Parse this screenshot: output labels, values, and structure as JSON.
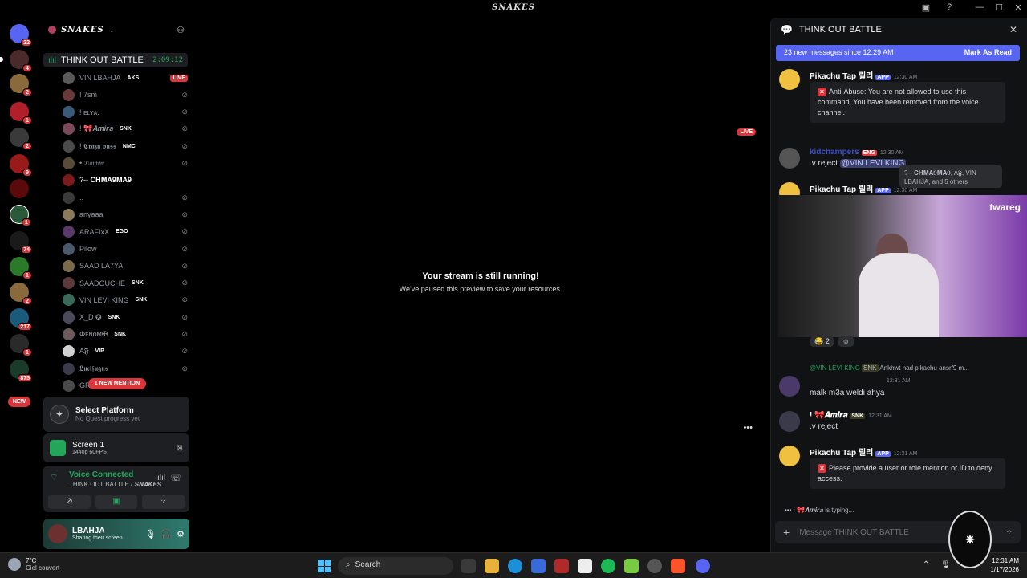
{
  "window": {
    "title": "𝑺𝑵𝑨𝑲𝑬𝑺",
    "minimize": "—",
    "maximize": "☐",
    "close": "✕"
  },
  "guilds": {
    "badges": [
      "22",
      "4",
      "2",
      "1",
      "2",
      "9",
      "1",
      "74",
      "1",
      "2",
      "217",
      "1",
      "875"
    ],
    "new_label": "NEW"
  },
  "server": {
    "name": "𝑺𝑵𝑨𝑲𝑬𝑺",
    "voice_channel": {
      "name": "THINK OUT BATTLE",
      "timer": "2:09:12"
    },
    "members": [
      {
        "name": "VIN LBAHJA",
        "tag": "AKS",
        "status": "LIVE"
      },
      {
        "name": "! 7sm",
        "tag": "",
        "status": ""
      },
      {
        "name": "! ᴇʟʏᴀ.",
        "tag": "",
        "status": ""
      },
      {
        "name": "! 🎀𝑨𝒎𝒊𝒓𝒂",
        "tag": "SNK",
        "status": ""
      },
      {
        "name": "! 𝕮𝖗𝖆𝖟𝖞 𝖕𝖚𝖘𝖘",
        "tag": "NMC",
        "status": ""
      },
      {
        "name": "• 𝔇𝔞𝔪𝔬𝔫",
        "tag": "",
        "status": ""
      },
      {
        "name": "?-- 𝐂𝐇𝐌𝐀𝟗𝐌𝐀𝟗",
        "tag": "",
        "status": ""
      },
      {
        "name": "..",
        "tag": "",
        "status": ""
      },
      {
        "name": "anyaaa",
        "tag": "",
        "status": ""
      },
      {
        "name": "ARAFIxX",
        "tag": "EGO",
        "status": ""
      },
      {
        "name": "Pilow",
        "tag": "",
        "status": ""
      },
      {
        "name": "SAAD LA7YA",
        "tag": "",
        "status": ""
      },
      {
        "name": "SAADOUCHE",
        "tag": "SNK",
        "status": ""
      },
      {
        "name": "VIN LEVI KING",
        "tag": "SNK",
        "status": ""
      },
      {
        "name": "X_D ✪",
        "tag": "SNK",
        "status": ""
      },
      {
        "name": "Φᴇɴᴏᴍ✠",
        "tag": "SNK",
        "status": ""
      },
      {
        "name": "A𝕱",
        "tag": "VIP",
        "status": ""
      },
      {
        "name": "𝕷𝖚𝖈𝖎𝖋𝖚𝖌𝖚𝖘",
        "tag": "",
        "status": ""
      },
      {
        "name": "GR",
        "tag": "",
        "status": ""
      }
    ],
    "mention_pill": "1 NEW MENTION"
  },
  "quest": {
    "title": "Select Platform",
    "subtitle": "No Quest progress yet"
  },
  "screen_share": {
    "title": "Screen 1",
    "quality": "1440p 60FPS"
  },
  "voice": {
    "status": "Voice Connected",
    "location": "THINK OUT BATTLE / 𝑺𝑵𝑨𝑲𝑬𝑺"
  },
  "user": {
    "name": "LBAHJA",
    "status": "Sharing their screen"
  },
  "stream": {
    "live": "LIVE",
    "heading": "Your stream is still running!",
    "subtext": "We've paused this preview to save your resources.",
    "more": "•••"
  },
  "chat": {
    "title": "THINK OUT BATTLE",
    "new_messages": "23 new messages since 12:29 AM",
    "mark_read": "Mark As Read",
    "msg1": {
      "author": "Pikachu Tap 릴리",
      "badge": "APP",
      "time": "12:30 AM",
      "embed": "Anti-Abuse: You are not allowed to use this command. You have been removed from the voice channel."
    },
    "tooltip": "?-- 𝐂𝐇𝐌𝐀𝟗𝐌𝐀𝟗, A𝕱, VIN LBAHJA, and 5 others",
    "msg2": {
      "author": "kidchampers",
      "tag": "ENG",
      "time": "12:30 AM",
      "body": ".v reject",
      "mention": "@VIN LEVI KING"
    },
    "msg3": {
      "author": "Pikachu Tap 릴리",
      "badge": "APP",
      "time": "12:30 AM"
    },
    "video_logo": "twareg",
    "reactions": {
      "laugh": "😂 2",
      "add": "☺"
    },
    "reply_ref": {
      "author": "@VIN LEVI KING",
      "tag": "SNK",
      "text": "Ankhwt had pikachu ansrf9 m..."
    },
    "msg4": {
      "time": "12:31 AM",
      "body": "malk m3a weldi ahya"
    },
    "msg5": {
      "author": "! 🎀𝑨𝒎𝒊𝒓𝒂",
      "tag": "SNK",
      "time": "12:31 AM",
      "body": ".v reject"
    },
    "msg6": {
      "author": "Pikachu Tap 릴리",
      "badge": "APP",
      "time": "12:31 AM",
      "embed": "Please provide a user or role mention or ID to deny access."
    },
    "typing": "! 🎀𝑨𝒎𝒊𝒓𝒂 is typing...",
    "composer_placeholder": "Message THINK OUT BATTLE"
  },
  "taskbar": {
    "temp": "7°C",
    "weather": "Ciel couvert",
    "search": "Search",
    "time": "12:31 AM",
    "date": "1/17/2026"
  },
  "colors": {
    "accent": "#5865f2",
    "live": "#da373c",
    "voice_green": "#23a55a"
  }
}
